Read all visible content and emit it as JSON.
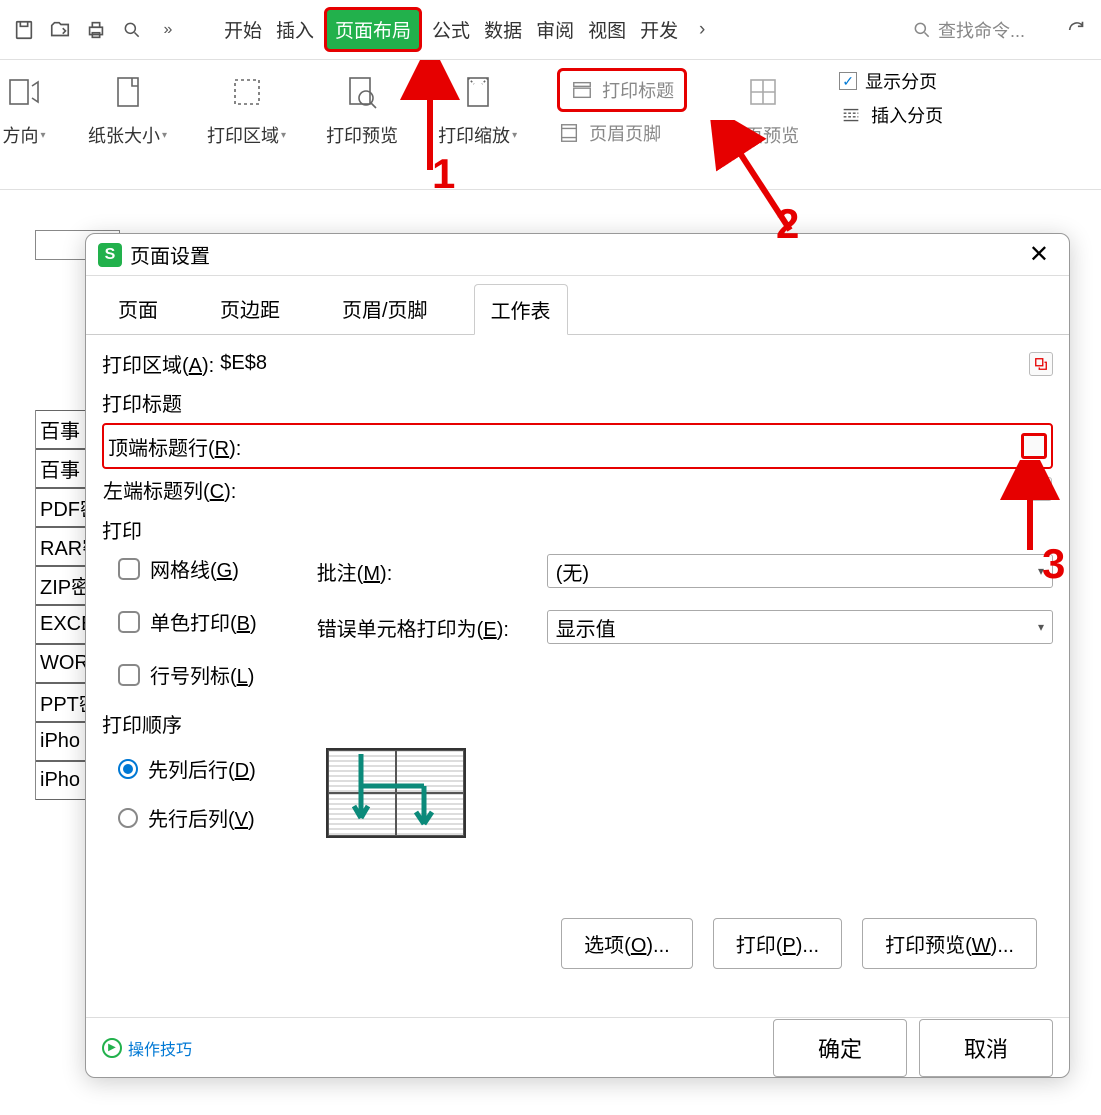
{
  "top_icons": [
    "save",
    "open",
    "print",
    "search-small"
  ],
  "tabs": {
    "items": [
      "开始",
      "插入",
      "页面布局",
      "公式",
      "数据",
      "审阅",
      "视图",
      "开发"
    ],
    "active_index": 2
  },
  "search": {
    "placeholder": "查找命令..."
  },
  "ribbon": {
    "direction": "方向",
    "paper_size": "纸张大小",
    "print_area": "打印区域",
    "print_preview": "打印预览",
    "print_zoom": "打印缩放",
    "print_titles": "打印标题",
    "header_footer": "页眉页脚",
    "page_break_preview": "分页预览",
    "show_page_break": "显示分页",
    "insert_page_break": "插入分页"
  },
  "annotations": {
    "n1": "1",
    "n2": "2",
    "n3": "3"
  },
  "sheet_cells": [
    "百事",
    "百事",
    "PDF密",
    "RAR密",
    "ZIP密",
    "EXCE",
    "WORD",
    "PPT密",
    "iPho",
    "iPho"
  ],
  "dialog": {
    "title": "页面设置",
    "tabs": [
      "页面",
      "页边距",
      "页眉/页脚",
      "工作表"
    ],
    "active_tab": 3,
    "print_area_label": "打印区域(",
    "print_area_key": "A",
    "print_area_end": "):",
    "print_area_value": "$E$8",
    "print_titles_label": "打印标题",
    "top_row_label": "顶端标题行(",
    "top_row_key": "R",
    "top_row_end": "):",
    "left_col_label": "左端标题列(",
    "left_col_key": "C",
    "left_col_end": "):",
    "print_section": "打印",
    "gridlines": "网格线(",
    "gridlines_key": "G",
    "gridlines_end": ")",
    "mono": "单色打印(",
    "mono_key": "B",
    "mono_end": ")",
    "rowcol": "行号列标(",
    "rowcol_key": "L",
    "rowcol_end": ")",
    "comments_label": "批注(",
    "comments_key": "M",
    "comments_end": "):",
    "comments_value": "(无)",
    "errors_label": "错误单元格打印为(",
    "errors_key": "E",
    "errors_end": "):",
    "errors_value": "显示值",
    "order_section": "打印顺序",
    "col_first": "先列后行(",
    "col_first_key": "D",
    "col_first_end": ")",
    "row_first": "先行后列(",
    "row_first_key": "V",
    "row_first_end": ")",
    "options_btn": "选项(",
    "options_key": "O",
    "options_end": ")...",
    "print_btn": "打印(",
    "print_key": "P",
    "print_end": ")...",
    "preview_btn": "打印预览(",
    "preview_key": "W",
    "preview_end": ")...",
    "tips_link": "操作技巧",
    "ok": "确定",
    "cancel": "取消"
  }
}
